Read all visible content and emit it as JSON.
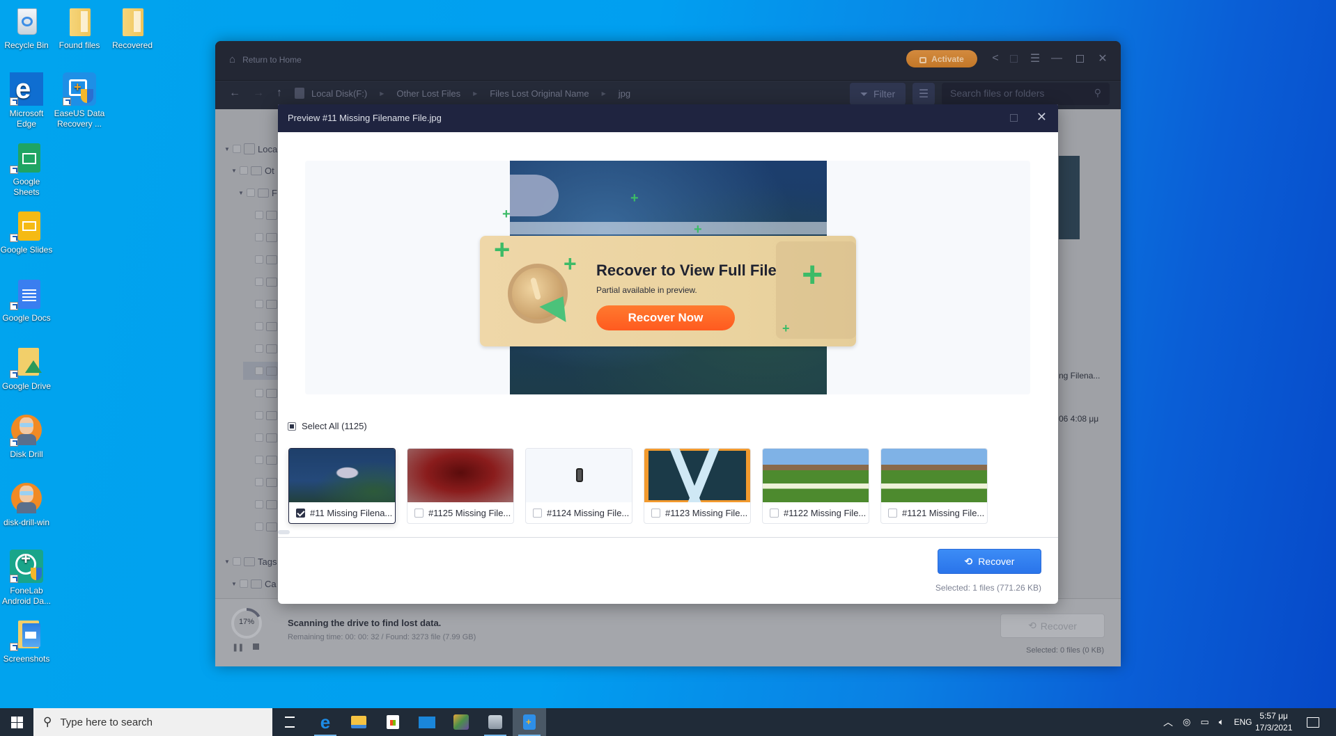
{
  "desktop": {
    "icons": [
      {
        "label": "Recycle Bin",
        "icon": "recycle-bin-icon"
      },
      {
        "label": "Found files",
        "icon": "folder-icon"
      },
      {
        "label": "Recovered",
        "icon": "folder-icon"
      },
      {
        "label": "Microsoft Edge",
        "icon": "edge-icon"
      },
      {
        "label": "EaseUS Data Recovery ...",
        "icon": "easeus-icon"
      },
      {
        "label": "Google Sheets",
        "icon": "google-sheets-icon"
      },
      {
        "label": "Google Slides",
        "icon": "google-slides-icon"
      },
      {
        "label": "Google Docs",
        "icon": "google-docs-icon"
      },
      {
        "label": "Google Drive",
        "icon": "google-drive-icon"
      },
      {
        "label": "Disk Drill",
        "icon": "disk-drill-icon"
      },
      {
        "label": "disk-drill-win",
        "icon": "disk-drill-icon"
      },
      {
        "label": "FoneLab Android Da...",
        "icon": "fonelab-icon"
      },
      {
        "label": "Screenshots",
        "icon": "screenshots-folder-icon"
      }
    ]
  },
  "app": {
    "return_home": "Return to Home",
    "activate_label": "Activate",
    "breadcrumb": [
      "Local Disk(F:)",
      "Other Lost Files",
      "Files Lost Original Name",
      "jpg"
    ],
    "filter_label": "Filter",
    "search_placeholder": "Search files or folders",
    "tree": [
      {
        "label": "Loca",
        "level": 0,
        "expanded": true
      },
      {
        "label": "Ot",
        "level": 1,
        "expanded": true
      },
      {
        "label": "F",
        "level": 2,
        "expanded": true
      },
      {
        "label": "Tags",
        "level": 0,
        "expanded": true
      },
      {
        "label": "Ca",
        "level": 1,
        "expanded": true
      }
    ],
    "right_peek": {
      "filename": "ng Filena...",
      "date": "06 4:08 μμ"
    },
    "scan": {
      "progress_percent": 17,
      "progress_label": "17%",
      "title": "Scanning the drive to find lost data.",
      "subtitle": "Remaining time: 00: 00: 32 / Found: 3273 file (7.99 GB)"
    },
    "recover_label": "Recover",
    "selected_text": "Selected: 0 files (0 KB)"
  },
  "dialog": {
    "title": "Preview #11 Missing Filename File.jpg",
    "banner": {
      "title": "Recover to View Full File",
      "subtitle": "Partial available in preview.",
      "button": "Recover Now"
    },
    "select_all_label": "Select All (1125)",
    "thumbnails": [
      {
        "label": "#11 Missing Filena...",
        "checked": true,
        "selected": true,
        "kind": "shark"
      },
      {
        "label": "#1125 Missing File...",
        "checked": false,
        "selected": false,
        "kind": "red"
      },
      {
        "label": "#1124 Missing File...",
        "checked": false,
        "selected": false,
        "kind": "blank"
      },
      {
        "label": "#1123 Missing File...",
        "checked": false,
        "selected": false,
        "kind": "x-logo"
      },
      {
        "label": "#1122 Missing File...",
        "checked": false,
        "selected": false,
        "kind": "castle"
      },
      {
        "label": "#1121 Missing File...",
        "checked": false,
        "selected": false,
        "kind": "castle"
      }
    ],
    "recover_label": "Recover",
    "selected_text": "Selected: 1 files (771.26 KB)"
  },
  "taskbar": {
    "search_placeholder": "Type here to search",
    "apps": [
      "task-view",
      "edge",
      "file-explorer",
      "store",
      "mail",
      "photos-app",
      "disk-app",
      "easeus"
    ],
    "tray": {
      "language": "ENG",
      "time": "5:57 μμ",
      "date": "17/3/2021"
    }
  },
  "colors": {
    "dialog_header": "#1f2440",
    "recover_blue": "#2f7ff0",
    "recover_now_orange": "#ff6a26",
    "activate_orange": "#c8802f",
    "banner_bg": "#ecd5a4",
    "plus_green": "#3cbb67"
  }
}
